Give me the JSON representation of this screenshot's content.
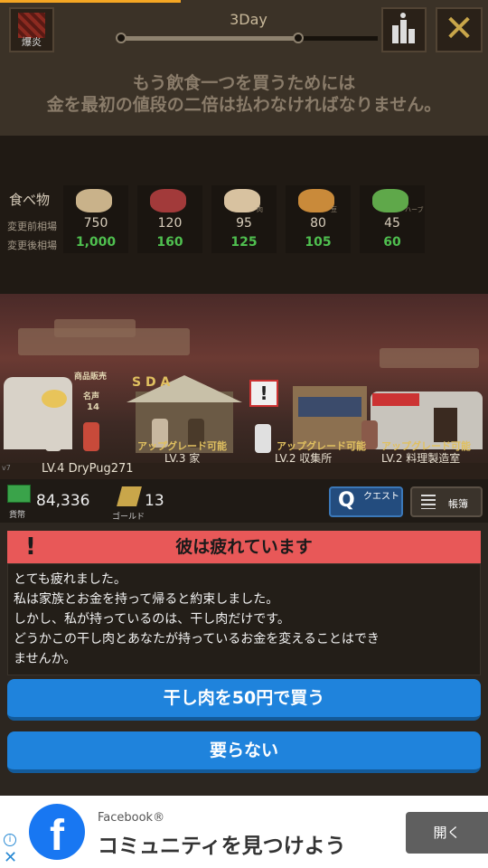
{
  "top": {
    "bakuen_label": "爆炎",
    "day_label": "3Day",
    "day_progress": 0.69,
    "message_line1": "もう飲食一つを買うためには",
    "message_line2": "金を最初の値段の二倍は払わなければなりません。"
  },
  "market": {
    "title": "食べ物",
    "before_label": "変更前相場",
    "after_label": "変更後相場",
    "items": [
      {
        "icon": "noodle-bowl-icon",
        "tag": "",
        "before": "750",
        "after": "1,000",
        "color": "#c9b28a"
      },
      {
        "icon": "meat-icon",
        "tag": "",
        "before": "120",
        "after": "160",
        "color": "#a23a3a"
      },
      {
        "icon": "fried-food-icon",
        "tag": "肉",
        "before": "95",
        "after": "125",
        "color": "#d8c2a0"
      },
      {
        "icon": "beans-icon",
        "tag": "豆",
        "before": "80",
        "after": "105",
        "color": "#c98a3a"
      },
      {
        "icon": "herb-icon",
        "tag": "ハーブ",
        "before": "45",
        "after": "60",
        "color": "#5fa84a"
      }
    ]
  },
  "scene": {
    "sda": "S D A",
    "upgrade1": "アップグレード可能",
    "upgrade2": "アップグレード可能",
    "upgrade3": "アップグレード可能",
    "building_home": "LV.3 家",
    "building_gather": "LV.2 収集所",
    "building_cook": "LV.2 料理製造室",
    "player_level": "LV.4 DryPug271",
    "sign_sales": "商品販売",
    "sign_count_label": "名声",
    "sign_count": "14",
    "warn_mark": "!",
    "side_label": "v7"
  },
  "resources": {
    "cash_label": "貨幣",
    "cash": "84,336",
    "gold_label": "ゴールド",
    "gold": "13",
    "quest_q": "Q",
    "quest_label": "クエスト",
    "ledger_label": "帳簿"
  },
  "dialog": {
    "title": "彼は疲れています",
    "lines": [
      "とても疲れました。",
      "私は家族とお金を持って帰ると約束しました。",
      "しかし、私が持っているのは、干し肉だけです。",
      "どうかこの干し肉とあなたが持っているお金を変えることはでき",
      "ませんか。"
    ],
    "buy_button": "干し肉を50円で買う",
    "decline_button": "要らない"
  },
  "ad": {
    "brand": "Facebook®",
    "headline": "コミュニティを見つけよう",
    "open_button": "開く",
    "logo_letter": "f"
  }
}
